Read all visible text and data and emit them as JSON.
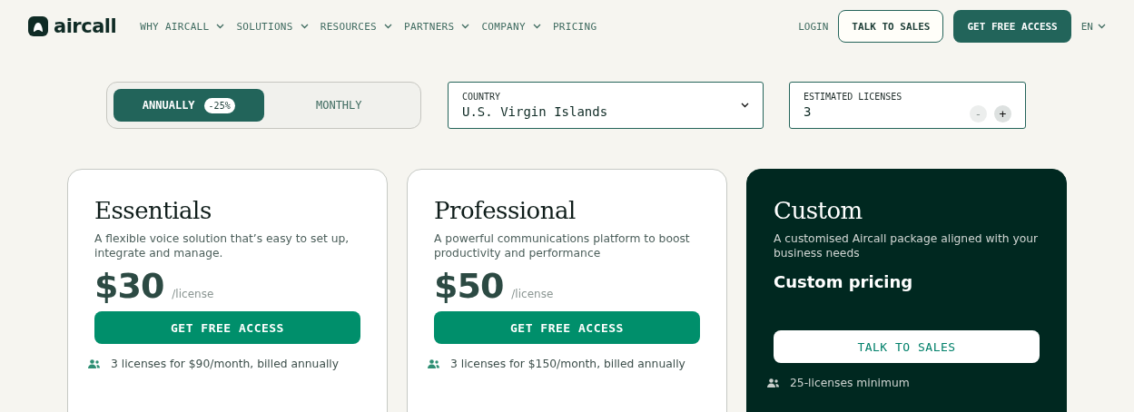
{
  "logo": {
    "text": "aircall"
  },
  "nav": {
    "items": [
      {
        "label": "WHY AIRCALL",
        "dropdown": true
      },
      {
        "label": "SOLUTIONS",
        "dropdown": true
      },
      {
        "label": "RESOURCES",
        "dropdown": true
      },
      {
        "label": "PARTNERS",
        "dropdown": true
      },
      {
        "label": "COMPANY",
        "dropdown": true
      },
      {
        "label": "PRICING",
        "dropdown": false
      }
    ],
    "login": "LOGIN",
    "talk_to_sales": "TALK TO SALES",
    "get_free_access": "GET FREE ACCESS",
    "language": "EN"
  },
  "billing": {
    "options": [
      {
        "label": "ANNUALLY",
        "badge": "-25%",
        "selected": true
      },
      {
        "label": "MONTHLY",
        "selected": false
      }
    ]
  },
  "country": {
    "label": "COUNTRY",
    "value": "U.S. Virgin Islands"
  },
  "licenses": {
    "label": "ESTIMATED LICENSES",
    "value": "3",
    "minus": "-",
    "plus": "+",
    "minus_disabled": true,
    "plus_disabled": false
  },
  "plans": [
    {
      "kind": "standard",
      "name": "Essentials",
      "description": "A flexible voice solution that’s easy to set up, integrate and manage.",
      "price": "$30",
      "unit": "/license",
      "button": "GET FREE ACCESS",
      "note": "3 licenses for $90/month, billed annually"
    },
    {
      "kind": "standard",
      "name": "Professional",
      "description": "A powerful communications platform to boost productivity and performance",
      "price": "$50",
      "unit": "/license",
      "button": "GET FREE ACCESS",
      "note": "3 licenses for $150/month, billed annually"
    },
    {
      "kind": "custom",
      "name": "Custom",
      "description": "A customised Aircall package aligned with your business needs",
      "price": "Custom pricing",
      "button": "TALK TO SALES",
      "note": "25-licenses minimum"
    }
  ]
}
